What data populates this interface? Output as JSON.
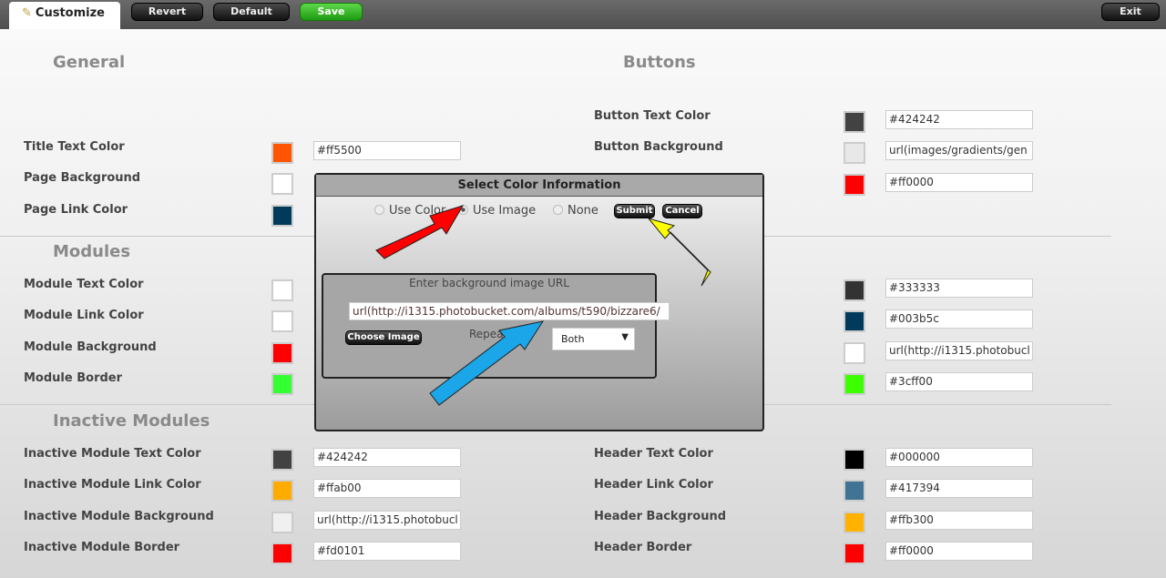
{
  "toolbar": {
    "tab": "Customize",
    "revert": "Revert",
    "default": "Default",
    "save": "Save",
    "exit": "Exit"
  },
  "sections": {
    "general": "General",
    "buttons": "Buttons",
    "modules": "Modules",
    "inactive": "Inactive Modules"
  },
  "general": [
    {
      "label": "Title Text Color",
      "color": "#ff5500",
      "value": "#ff5500"
    },
    {
      "label": "Page Background",
      "color": "#ffffff"
    },
    {
      "label": "Page Link Color",
      "color": "#003b5c"
    }
  ],
  "buttons": [
    {
      "label": "Button Text Color",
      "color": "#424242",
      "value": "#424242"
    },
    {
      "label": "Button Background",
      "color": "#e8e8e8",
      "value": "url(images/gradients/gen"
    },
    {
      "color": "#ff0000",
      "value": "#ff0000"
    }
  ],
  "modules": [
    {
      "label": "Module Text Color",
      "color": "#ffffff"
    },
    {
      "label": "Module Link Color",
      "color": "#ffffff"
    },
    {
      "label": "Module Background",
      "color": "#ff0000"
    },
    {
      "label": "Module Border",
      "color": "#33ff33"
    }
  ],
  "modules_right": [
    {
      "color": "#333333",
      "value": "#333333"
    },
    {
      "color": "#003b5c",
      "value": "#003b5c"
    },
    {
      "color": "#ffffff",
      "value": "url(http://i1315.photobucl"
    },
    {
      "color": "#3cff00",
      "value": "#3cff00"
    }
  ],
  "inactive": [
    {
      "label": "Inactive Module Text Color",
      "color": "#424242",
      "value": "#424242"
    },
    {
      "label": "Inactive Module Link Color",
      "color": "#ffab00",
      "value": "#ffab00"
    },
    {
      "label": "Inactive Module Background",
      "color": "#f0f0f0",
      "value": "url(http://i1315.photobucl"
    },
    {
      "label": "Inactive Module Border",
      "color": "#fd0101",
      "value": "#fd0101"
    }
  ],
  "header": [
    {
      "label": "Header Text Color",
      "color": "#000000",
      "value": "#000000"
    },
    {
      "label": "Header Link Color",
      "color": "#417394",
      "value": "#417394"
    },
    {
      "label": "Header Background",
      "color": "#ffb300",
      "value": "#ffb300"
    },
    {
      "label": "Header Border",
      "color": "#ff0000",
      "value": "#ff0000"
    }
  ],
  "modal": {
    "title": "Select Color Information",
    "use_color": "Use Color",
    "use_image": "Use Image",
    "none": "None",
    "submit": "Submit",
    "cancel": "Cancel",
    "inner_title": "Enter background image URL",
    "url": "url(http://i1315.photobucket.com/albums/t590/bizzare6/",
    "choose_image": "Choose Image",
    "repeat_label": "Repeat",
    "repeat_value": "Both"
  }
}
